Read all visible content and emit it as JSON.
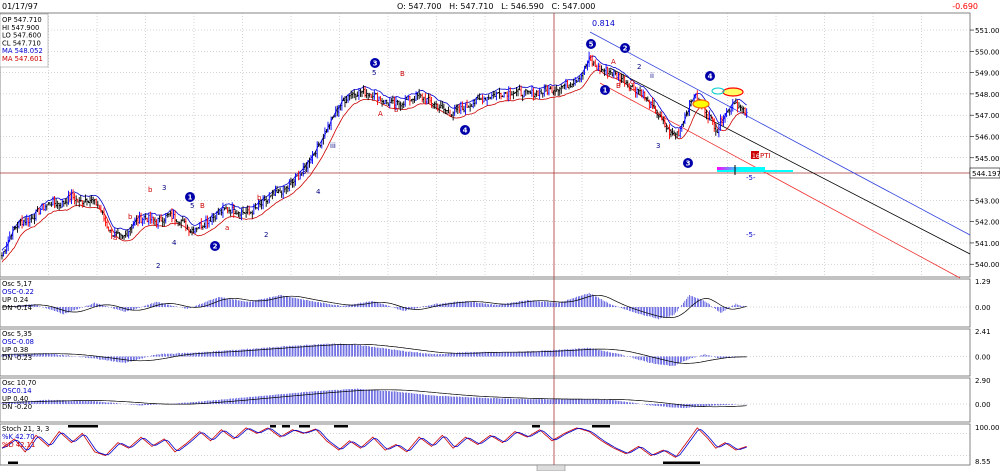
{
  "header": {
    "date": "01/17/97",
    "ohlc": "O: 547.700   H: 547.710   L: 546.590   C: 547.000",
    "change": "-0.690"
  },
  "price_info": {
    "lines": [
      {
        "text": "OP 547.710",
        "color": "#000000"
      },
      {
        "text": "HI  547.900",
        "color": "#000000"
      },
      {
        "text": "LO  547.600",
        "color": "#000000"
      },
      {
        "text": "CL  547.710",
        "color": "#000000"
      },
      {
        "text": "MA  548.052",
        "color": "#0000cc"
      },
      {
        "text": "MA  547.601",
        "color": "#cc0000"
      }
    ]
  },
  "annotations": {
    "fib_ratio": "0.814",
    "pti_label": "PTI",
    "pti_value": "16",
    "minus5_a": "-5-",
    "minus5_b": "-5-",
    "price_marker": "544.197"
  },
  "panels": {
    "osc1": {
      "title": "Osc 5,17",
      "osc": "OSC-0.22",
      "up": "UP  0.24",
      "dn": "DN  -0.14",
      "top_tick": "1.29",
      "mid_tick": "0.00"
    },
    "osc2": {
      "title": "Osc 5,35",
      "osc": "OSC-0.08",
      "up": "UP  0.38",
      "dn": "DN  -0.23",
      "top_tick": "2.41",
      "mid_tick": "0.00"
    },
    "osc3": {
      "title": "Osc 10,70",
      "osc": "OSC0.14",
      "up": "UP  0.40",
      "dn": "DN  -0.20",
      "top_tick": "2.90",
      "mid_tick": "0.00"
    },
    "stoch": {
      "title": "Stoch 21, 3, 3",
      "k": "%K  42.70",
      "d": "%D  42.11",
      "top_tick": "100.00",
      "bot_tick": "8.55"
    }
  },
  "colors": {
    "up_bar": "#0000ff",
    "down_bar": "#ff0000",
    "neutral_bar": "#000000",
    "ma_fast": "#0000cc",
    "ma_slow": "#cc0000",
    "grid": "#999999"
  },
  "chart_data": {
    "type": "candlestick",
    "title": "",
    "ylim": [
      539.4,
      551.8
    ],
    "y_ticks": [
      "551.000",
      "550.000",
      "549.000",
      "548.000",
      "547.000",
      "546.000",
      "545.000",
      "543.000",
      "542.000",
      "541.000",
      "540.000"
    ],
    "y_tick_values": [
      551,
      550,
      549,
      548,
      547,
      546,
      545,
      543,
      542,
      541,
      540
    ],
    "anchors": [
      [
        0,
        540.4
      ],
      [
        6,
        541.5
      ],
      [
        12,
        542.0
      ],
      [
        18,
        542.1
      ],
      [
        25,
        542.6
      ],
      [
        32,
        542.9
      ],
      [
        38,
        542.8
      ],
      [
        45,
        543.2
      ],
      [
        50,
        542.9
      ],
      [
        55,
        543.1
      ],
      [
        62,
        542.8
      ],
      [
        70,
        541.5
      ],
      [
        78,
        541.2
      ],
      [
        85,
        541.9
      ],
      [
        92,
        542.2
      ],
      [
        100,
        542.0
      ],
      [
        108,
        542.3
      ],
      [
        115,
        542.1
      ],
      [
        122,
        541.6
      ],
      [
        130,
        541.9
      ],
      [
        138,
        542.3
      ],
      [
        145,
        542.6
      ],
      [
        152,
        542.5
      ],
      [
        160,
        542.4
      ],
      [
        168,
        542.8
      ],
      [
        175,
        543.2
      ],
      [
        185,
        543.6
      ],
      [
        195,
        544.4
      ],
      [
        205,
        545.6
      ],
      [
        212,
        546.6
      ],
      [
        218,
        547.4
      ],
      [
        225,
        548.0
      ],
      [
        232,
        548.1
      ],
      [
        240,
        548.0
      ],
      [
        248,
        547.6
      ],
      [
        255,
        547.5
      ],
      [
        262,
        547.7
      ],
      [
        270,
        547.9
      ],
      [
        278,
        547.6
      ],
      [
        285,
        547.3
      ],
      [
        290,
        547.1
      ],
      [
        298,
        547.3
      ],
      [
        305,
        547.6
      ],
      [
        312,
        547.8
      ],
      [
        320,
        548.0
      ],
      [
        330,
        548.1
      ],
      [
        340,
        548.0
      ],
      [
        350,
        548.1
      ],
      [
        360,
        548.3
      ],
      [
        368,
        548.5
      ],
      [
        375,
        548.9
      ],
      [
        380,
        549.6
      ],
      [
        384,
        549.3
      ],
      [
        388,
        549.1
      ],
      [
        392,
        549.1
      ],
      [
        397,
        548.9
      ],
      [
        402,
        548.7
      ],
      [
        408,
        548.3
      ],
      [
        414,
        548.1
      ],
      [
        418,
        547.6
      ],
      [
        423,
        547.2
      ],
      [
        428,
        546.6
      ],
      [
        433,
        546.1
      ],
      [
        438,
        546.2
      ],
      [
        443,
        547.2
      ],
      [
        448,
        547.9
      ],
      [
        453,
        547.5
      ],
      [
        458,
        546.9
      ],
      [
        463,
        546.3
      ],
      [
        467,
        547.0
      ],
      [
        470,
        547.2
      ],
      [
        474,
        547.7
      ],
      [
        478,
        547.3
      ],
      [
        482,
        547.0
      ]
    ],
    "osc1": [
      [
        0,
        0.0
      ],
      [
        20,
        0.15
      ],
      [
        40,
        -0.35
      ],
      [
        60,
        0.2
      ],
      [
        80,
        -0.25
      ],
      [
        100,
        0.25
      ],
      [
        120,
        -0.1
      ],
      [
        140,
        0.5
      ],
      [
        160,
        0.25
      ],
      [
        180,
        0.6
      ],
      [
        200,
        0.3
      ],
      [
        220,
        0.05
      ],
      [
        240,
        0.3
      ],
      [
        260,
        -0.2
      ],
      [
        280,
        0.15
      ],
      [
        300,
        0.3
      ],
      [
        320,
        0.1
      ],
      [
        340,
        0.35
      ],
      [
        360,
        0.2
      ],
      [
        380,
        0.7
      ],
      [
        395,
        0.1
      ],
      [
        410,
        -0.3
      ],
      [
        425,
        -0.6
      ],
      [
        435,
        -0.4
      ],
      [
        445,
        0.6
      ],
      [
        455,
        0.3
      ],
      [
        465,
        -0.3
      ],
      [
        475,
        0.15
      ],
      [
        482,
        0.0
      ]
    ],
    "osc2": [
      [
        0,
        0.1
      ],
      [
        30,
        0.15
      ],
      [
        60,
        -0.1
      ],
      [
        80,
        -0.3
      ],
      [
        100,
        0.1
      ],
      [
        130,
        0.2
      ],
      [
        160,
        0.35
      ],
      [
        190,
        0.5
      ],
      [
        215,
        0.6
      ],
      [
        235,
        0.5
      ],
      [
        260,
        0.25
      ],
      [
        280,
        0.1
      ],
      [
        300,
        0.2
      ],
      [
        330,
        0.2
      ],
      [
        360,
        0.3
      ],
      [
        380,
        0.4
      ],
      [
        400,
        0.1
      ],
      [
        420,
        -0.3
      ],
      [
        435,
        -0.45
      ],
      [
        445,
        -0.1
      ],
      [
        455,
        0.1
      ],
      [
        465,
        -0.1
      ],
      [
        482,
        0.0
      ]
    ],
    "osc3": [
      [
        0,
        0.1
      ],
      [
        30,
        0.3
      ],
      [
        60,
        0.2
      ],
      [
        90,
        -0.1
      ],
      [
        120,
        0.1
      ],
      [
        160,
        0.5
      ],
      [
        200,
        0.9
      ],
      [
        230,
        1.1
      ],
      [
        255,
        0.9
      ],
      [
        280,
        0.6
      ],
      [
        310,
        0.45
      ],
      [
        340,
        0.35
      ],
      [
        370,
        0.35
      ],
      [
        395,
        0.3
      ],
      [
        420,
        -0.1
      ],
      [
        440,
        -0.3
      ],
      [
        455,
        -0.15
      ],
      [
        482,
        0.0
      ]
    ],
    "stoch_k": [
      [
        0,
        40
      ],
      [
        8,
        65
      ],
      [
        15,
        30
      ],
      [
        22,
        75
      ],
      [
        30,
        45
      ],
      [
        37,
        85
      ],
      [
        45,
        55
      ],
      [
        52,
        80
      ],
      [
        60,
        30
      ],
      [
        67,
        20
      ],
      [
        75,
        55
      ],
      [
        82,
        40
      ],
      [
        90,
        70
      ],
      [
        97,
        45
      ],
      [
        105,
        65
      ],
      [
        112,
        30
      ],
      [
        120,
        55
      ],
      [
        128,
        85
      ],
      [
        135,
        60
      ],
      [
        142,
        90
      ],
      [
        150,
        65
      ],
      [
        158,
        95
      ],
      [
        165,
        80
      ],
      [
        172,
        95
      ],
      [
        180,
        70
      ],
      [
        188,
        90
      ],
      [
        195,
        80
      ],
      [
        203,
        92
      ],
      [
        210,
        60
      ],
      [
        218,
        35
      ],
      [
        225,
        60
      ],
      [
        232,
        40
      ],
      [
        240,
        70
      ],
      [
        248,
        35
      ],
      [
        255,
        50
      ],
      [
        262,
        30
      ],
      [
        270,
        70
      ],
      [
        278,
        45
      ],
      [
        285,
        75
      ],
      [
        292,
        40
      ],
      [
        300,
        70
      ],
      [
        308,
        50
      ],
      [
        316,
        75
      ],
      [
        324,
        55
      ],
      [
        332,
        85
      ],
      [
        340,
        70
      ],
      [
        348,
        90
      ],
      [
        356,
        60
      ],
      [
        364,
        80
      ],
      [
        372,
        95
      ],
      [
        380,
        85
      ],
      [
        388,
        60
      ],
      [
        396,
        40
      ],
      [
        404,
        25
      ],
      [
        412,
        45
      ],
      [
        420,
        20
      ],
      [
        428,
        35
      ],
      [
        436,
        15
      ],
      [
        444,
        60
      ],
      [
        450,
        95
      ],
      [
        456,
        70
      ],
      [
        462,
        40
      ],
      [
        468,
        55
      ],
      [
        475,
        35
      ],
      [
        482,
        45
      ]
    ]
  }
}
